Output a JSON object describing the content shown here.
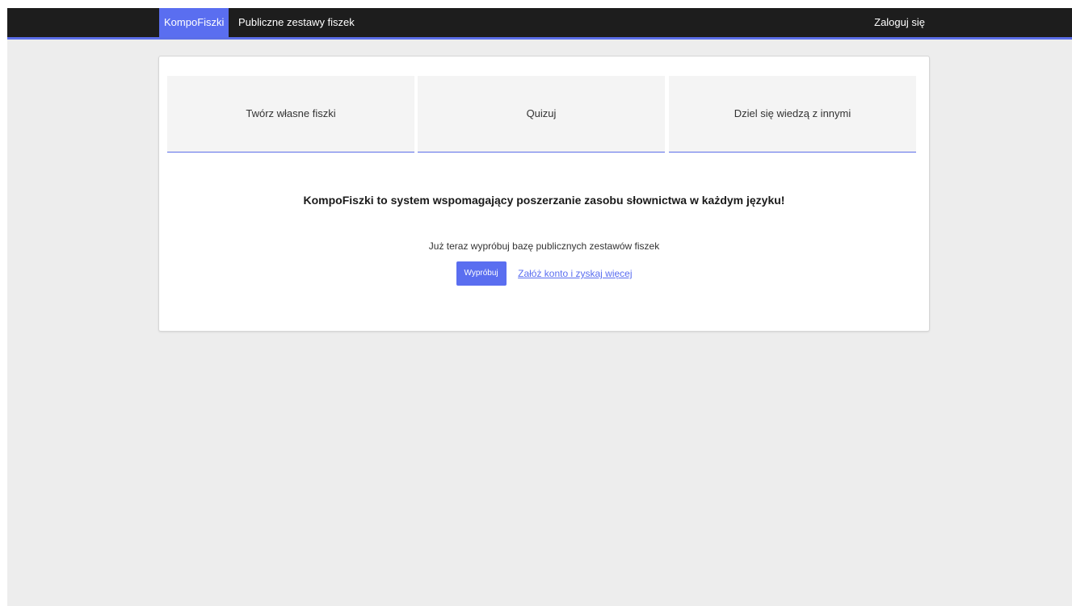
{
  "navbar": {
    "brand": "KompoFiszki",
    "public_sets_link": "Publiczne zestawy fiszek",
    "login_link": "Zaloguj się"
  },
  "features": [
    {
      "label": "Twórz własne fiszki"
    },
    {
      "label": "Quizuj"
    },
    {
      "label": "Dziel się wiedzą z innymi"
    }
  ],
  "main": {
    "headline": "KompoFiszki to system wspomagający poszerzanie zasobu słownictwa w każdym języku!",
    "subtext": "Już teraz wypróbuj bazę publicznych zestawów fiszek",
    "try_button": "Wypróbuj",
    "register_link": "Załóż konto i zyskaj więcej"
  },
  "colors": {
    "accent": "#5a6ef0",
    "navbar_bg": "#1d1d1d",
    "page_bg": "#ededed"
  }
}
